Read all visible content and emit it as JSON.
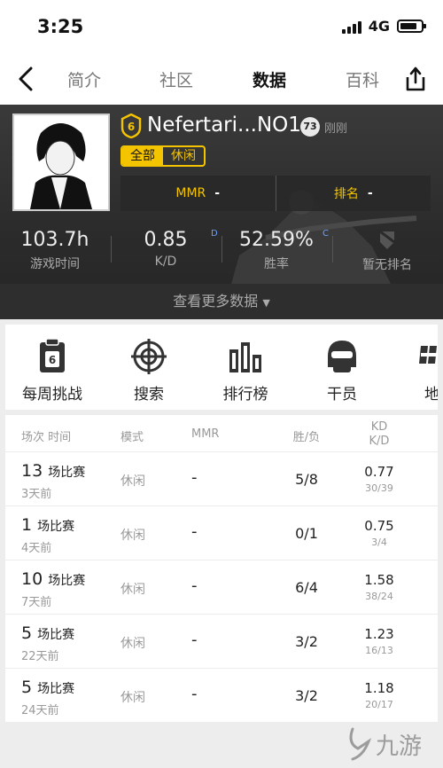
{
  "status": {
    "time": "3:25",
    "network": "4G"
  },
  "nav": {
    "tabs": [
      {
        "label": "简介"
      },
      {
        "label": "社区"
      },
      {
        "label": "数据",
        "active": true
      },
      {
        "label": "百科"
      }
    ]
  },
  "profile": {
    "name": "Nefertari...NO1",
    "level": "73",
    "updated": "刚刚",
    "modes": [
      "全部",
      "休闲"
    ],
    "selected_mode": "全部",
    "mmr": {
      "label": "MMR",
      "value": "-"
    },
    "rank": {
      "label": "排名",
      "value": "-"
    }
  },
  "stats": [
    {
      "value": "103.7h",
      "label": "游戏时间"
    },
    {
      "value": "0.85",
      "label": "K/D",
      "tag": "D"
    },
    {
      "value": "52.59%",
      "label": "胜率",
      "tag": "C"
    },
    {
      "value": "",
      "label": "暂无排名"
    }
  ],
  "more_data": "查看更多数据",
  "menu": [
    {
      "label": "每周挑战"
    },
    {
      "label": "搜索"
    },
    {
      "label": "排行榜"
    },
    {
      "label": "干员"
    },
    {
      "label": "地"
    }
  ],
  "table": {
    "headers": {
      "session_time": "场次 时间",
      "mode": "模式",
      "mmr": "MMR",
      "wl": "胜/负",
      "kd_line1": "KD",
      "kd_line2": "K/D"
    },
    "match_suffix": "场比赛",
    "rows": [
      {
        "count": "13",
        "ago": "3天前",
        "mode": "休闲",
        "mmr": "-",
        "wl": "5/8",
        "kd": "0.77",
        "kd_detail": "30/39"
      },
      {
        "count": "1",
        "ago": "4天前",
        "mode": "休闲",
        "mmr": "-",
        "wl": "0/1",
        "kd": "0.75",
        "kd_detail": "3/4"
      },
      {
        "count": "10",
        "ago": "7天前",
        "mode": "休闲",
        "mmr": "-",
        "wl": "6/4",
        "kd": "1.58",
        "kd_detail": "38/24"
      },
      {
        "count": "5",
        "ago": "22天前",
        "mode": "休闲",
        "mmr": "-",
        "wl": "3/2",
        "kd": "1.23",
        "kd_detail": "16/13"
      },
      {
        "count": "5",
        "ago": "24天前",
        "mode": "休闲",
        "mmr": "-",
        "wl": "3/2",
        "kd": "1.18",
        "kd_detail": "20/17"
      }
    ]
  },
  "colors": {
    "accent": "#f5c400",
    "tag_blue": "#6aa0ff",
    "hero_bg": "#2b2b2b"
  },
  "watermark": "九游"
}
